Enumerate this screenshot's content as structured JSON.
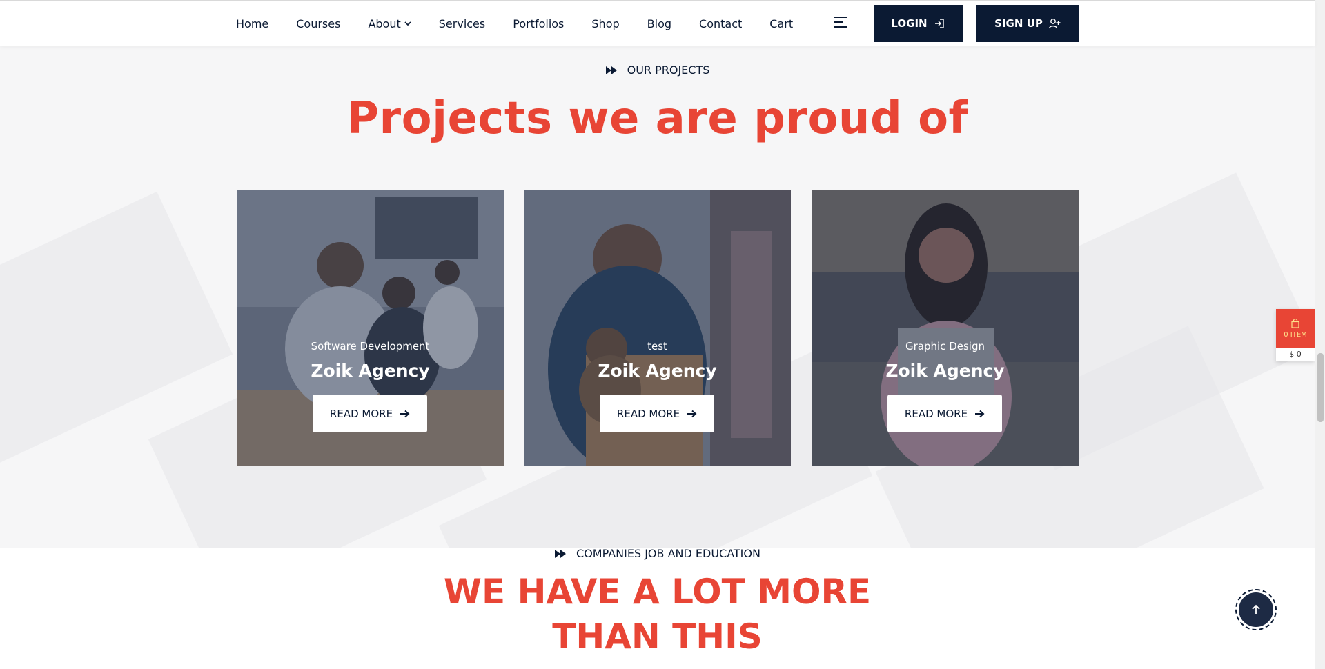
{
  "nav": {
    "items": [
      {
        "label": "Home"
      },
      {
        "label": "Courses"
      },
      {
        "label": "About"
      },
      {
        "label": "Services"
      },
      {
        "label": "Portfolios"
      },
      {
        "label": "Shop"
      },
      {
        "label": "Blog"
      },
      {
        "label": "Contact"
      },
      {
        "label": "Cart"
      }
    ],
    "login_label": "LOGIN",
    "signup_label": "SIGN UP"
  },
  "projects": {
    "eyebrow": "OUR PROJECTS",
    "title": "Projects we are proud of",
    "cards": [
      {
        "category": "Software Development",
        "name": "Zoik Agency",
        "button": "READ MORE"
      },
      {
        "category": "test",
        "name": "Zoik Agency",
        "button": "READ MORE"
      },
      {
        "category": "Graphic Design",
        "name": "Zoik Agency",
        "button": "READ MORE"
      }
    ]
  },
  "more": {
    "eyebrow": "COMPANIES JOB AND EDUCATION",
    "title_line1": "WE HAVE A LOT MORE",
    "title_line2": "THAN THIS"
  },
  "cart_widget": {
    "items": "0 ITEM",
    "total": "$ 0"
  },
  "colors": {
    "accent": "#e84535",
    "navy": "#0b1a33"
  }
}
